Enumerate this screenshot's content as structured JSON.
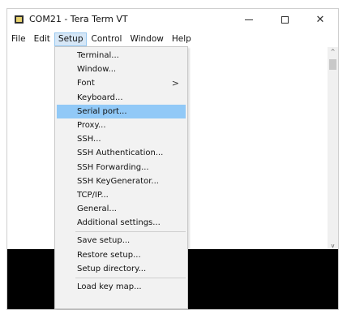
{
  "window": {
    "title": "COM21 - Tera Term VT"
  },
  "menubar": {
    "items": [
      "File",
      "Edit",
      "Setup",
      "Control",
      "Window",
      "Help"
    ],
    "active": "Setup"
  },
  "setup_menu": {
    "items": [
      {
        "label": "Terminal..."
      },
      {
        "label": "Window..."
      },
      {
        "label": "Font",
        "submenu_arrow": ">"
      },
      {
        "label": "Keyboard..."
      },
      {
        "label": "Serial port...",
        "selected": true
      },
      {
        "label": "Proxy..."
      },
      {
        "label": "SSH..."
      },
      {
        "label": "SSH Authentication..."
      },
      {
        "label": "SSH Forwarding..."
      },
      {
        "label": "SSH KeyGenerator..."
      },
      {
        "label": "TCP/IP..."
      },
      {
        "label": "General..."
      },
      {
        "label": "Additional settings..."
      },
      {
        "label": "Save setup..."
      },
      {
        "label": "Restore setup..."
      },
      {
        "label": "Setup directory..."
      },
      {
        "label": "Load key map..."
      }
    ]
  },
  "scrollbar": {
    "up_arrow": "^",
    "down_arrow": "v"
  },
  "icons": {
    "app": "terminal-app-icon",
    "minimize": "minimize-icon",
    "maximize": "maximize-icon",
    "close": "close-icon",
    "submenu": "chevron-right-icon"
  },
  "colors": {
    "selected_menu_item": "#91c9f7",
    "active_menubar_item": "#d6e7f7",
    "menu_background": "#f2f2f2",
    "terminal_bottom_panel": "#000000"
  }
}
